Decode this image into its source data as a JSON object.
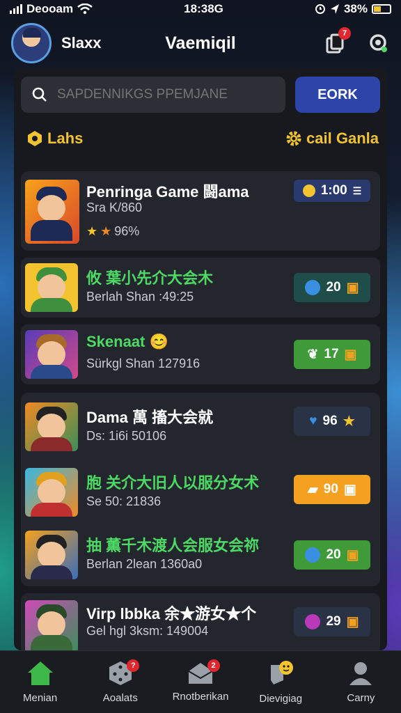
{
  "status_bar": {
    "carrier": "Deooam",
    "time": "18:38G",
    "battery_percent": "38%"
  },
  "header": {
    "user_name": "Slaxx",
    "app_title": "Vaemiqil",
    "notification_badge": "7"
  },
  "search": {
    "placeholder": "SAPDENNIKGS PPEMJANE",
    "button_label": "EORK"
  },
  "filters": {
    "left_label": "Lahs",
    "right_label": "cail Ganla"
  },
  "games": [
    {
      "title": "Penringa Game 闘ama",
      "subtitle": "Sra K/860",
      "rating": "96%",
      "pill_value": "1:00",
      "title_color": "#ffffff"
    },
    {
      "title": "攸 葉小先介大会木",
      "subtitle": "Berlah Shan :49:25",
      "pill_value": "20",
      "title_color": "#4cd964"
    },
    {
      "title": "Skenaat 😊",
      "subtitle": "Sürkgl Shan 127916",
      "pill_value": "17",
      "title_color": "#4cd964"
    },
    {
      "title": "Dama 萬 搐大会就",
      "subtitle": "Ds: 1i6i 50106",
      "pill_value": "96",
      "title_color": "#ffffff"
    },
    {
      "title": "胞 关介大旧人以服分女术",
      "subtitle": "Se 50: 21836",
      "pill_value": "90",
      "title_color": "#4cd964"
    },
    {
      "title": "抽 薫千木渡人会服女会祢",
      "subtitle": "Berlan 2lean 1360a0",
      "pill_value": "20",
      "title_color": "#4cd964"
    },
    {
      "title": "Virp lbbka 余★游女★个",
      "subtitle": "Gel hgl 3ksm: 149004",
      "pill_value": "29",
      "title_color": "#ffffff"
    }
  ],
  "tabs": [
    {
      "label": "Menian",
      "icon": "home-icon",
      "badge": ""
    },
    {
      "label": "Aoalats",
      "icon": "dice-icon",
      "badge": "?"
    },
    {
      "label": "Rnotberikan",
      "icon": "mail-icon",
      "badge": "2"
    },
    {
      "label": "Dievigiag",
      "icon": "chat-icon",
      "badge": ""
    },
    {
      "label": "Carny",
      "icon": "profile-icon",
      "badge": ""
    }
  ],
  "colors": {
    "accent_yellow": "#f4c430",
    "accent_green": "#4cd964",
    "search_button": "#2d45a8",
    "home_active": "#3fb84a"
  }
}
